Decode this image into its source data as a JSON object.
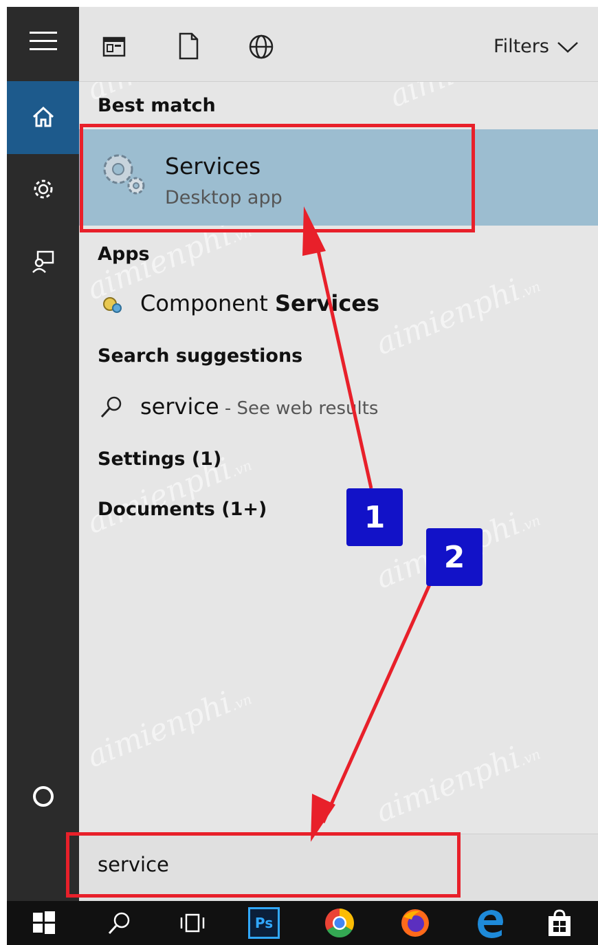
{
  "toolbar": {
    "filters_label": "Filters"
  },
  "sections": {
    "best_match": "Best match",
    "apps": "Apps",
    "search_suggestions": "Search suggestions",
    "settings": "Settings (1)",
    "documents": "Documents (1+)"
  },
  "best_match": {
    "title": "Services",
    "subtitle": "Desktop app"
  },
  "apps": {
    "item_prefix": "Component ",
    "item_bold": "Services"
  },
  "suggestion": {
    "query": "service",
    "hint": " - See web results"
  },
  "search": {
    "value": "service"
  },
  "annotations": {
    "badge1": "1",
    "badge2": "2"
  },
  "taskbar": {
    "photoshop_label": "Ps"
  },
  "watermark": {
    "text": "aimienphi",
    "suffix": ".vn"
  },
  "colors": {
    "accent": "#1d5a8c",
    "highlight": "#9cbdd0",
    "annotation_red": "#e8202a",
    "badge_blue": "#1212c8"
  },
  "icons": {
    "left_rail": [
      "hamburger-menu-icon",
      "home-icon",
      "gear-icon",
      "feedback-person-icon",
      "cortana-circle-icon"
    ],
    "toolbar": [
      "apps-window-icon",
      "document-icon",
      "web-globe-icon",
      "chevron-down-icon"
    ],
    "taskbar": [
      "windows-start-icon",
      "search-icon",
      "task-view-icon",
      "photoshop-icon",
      "chrome-icon",
      "firefox-icon",
      "edge-icon",
      "store-bag-icon"
    ]
  }
}
